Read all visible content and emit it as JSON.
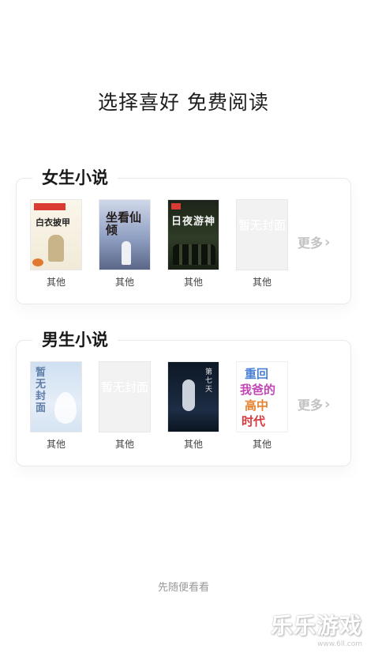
{
  "headline": "选择喜好 免费阅读",
  "sections": [
    {
      "title": "女生小说",
      "more_label": "更多",
      "books": [
        {
          "category": "其他",
          "cover_text": "白衣披甲",
          "cover_style": "illustrated-cream"
        },
        {
          "category": "其他",
          "cover_text": "坐看仙倾",
          "cover_style": "illustrated-blue"
        },
        {
          "category": "其他",
          "cover_text": "日夜游神",
          "cover_style": "illustrated-dark-green"
        },
        {
          "category": "其他",
          "cover_text": "暂无封面",
          "cover_style": "placeholder"
        }
      ]
    },
    {
      "title": "男生小说",
      "more_label": "更多",
      "books": [
        {
          "category": "其他",
          "cover_text": "暂无封面",
          "cover_style": "light-blue-feather"
        },
        {
          "category": "其他",
          "cover_text": "暂无封面",
          "cover_style": "placeholder"
        },
        {
          "category": "其他",
          "cover_text": "第七天",
          "cover_style": "illustrated-dark-blue"
        },
        {
          "category": "其他",
          "cover_text": "重回我爸的高中时代",
          "cover_style": "colorful-text"
        }
      ]
    }
  ],
  "browse_label": "先随便看看",
  "watermark": {
    "text": "乐乐游戏",
    "url": "www.6ll.com"
  },
  "colors": {
    "background": "#ffffff",
    "more": "#c2c2c2",
    "muted": "#9a9a9a",
    "card_border": "#e9e9e9"
  }
}
